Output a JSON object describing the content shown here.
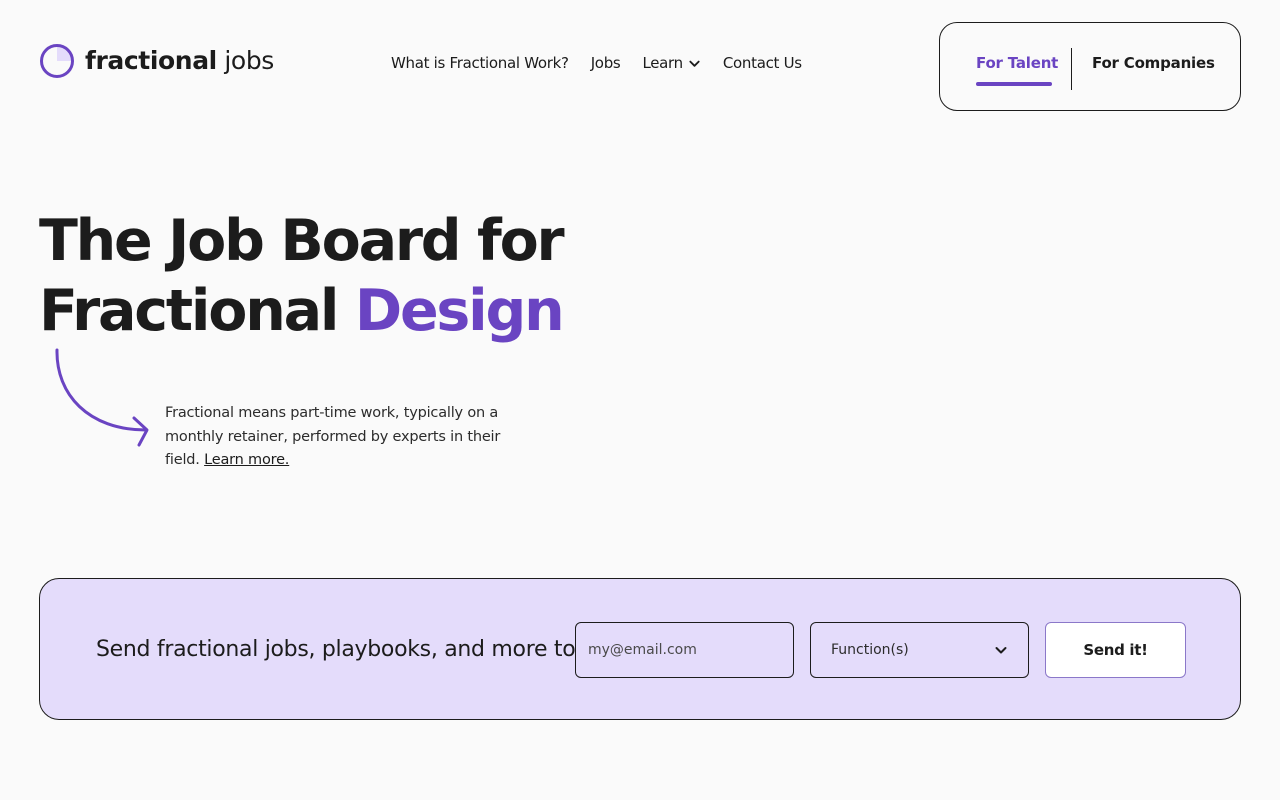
{
  "brand": {
    "name_bold": "fractional",
    "name_light": " jobs",
    "accent_color": "#6a44c2",
    "logo_icon": "fractional-circle-icon"
  },
  "nav": {
    "items": [
      {
        "label": "What is Fractional Work?"
      },
      {
        "label": "Jobs"
      },
      {
        "label": "Learn",
        "icon": "chevron-down-icon"
      },
      {
        "label": "Contact Us"
      }
    ]
  },
  "audience": {
    "talent_label": "For Talent",
    "companies_label": "For Companies",
    "active": "talent"
  },
  "hero": {
    "title_line1": "The Job Board for",
    "title_line2_prefix": "Fractional ",
    "title_line2_accent": "Design",
    "description": "Fractional means part-time work, typically on a monthly retainer, performed by experts in their field. ",
    "learn_more_label": "Learn more."
  },
  "signup": {
    "prompt": "Send fractional jobs, playbooks, and more to",
    "email_placeholder": "my@email.com",
    "function_label": "Function(s)",
    "submit_label": "Send it!",
    "background_color": "#e4dcfb"
  }
}
